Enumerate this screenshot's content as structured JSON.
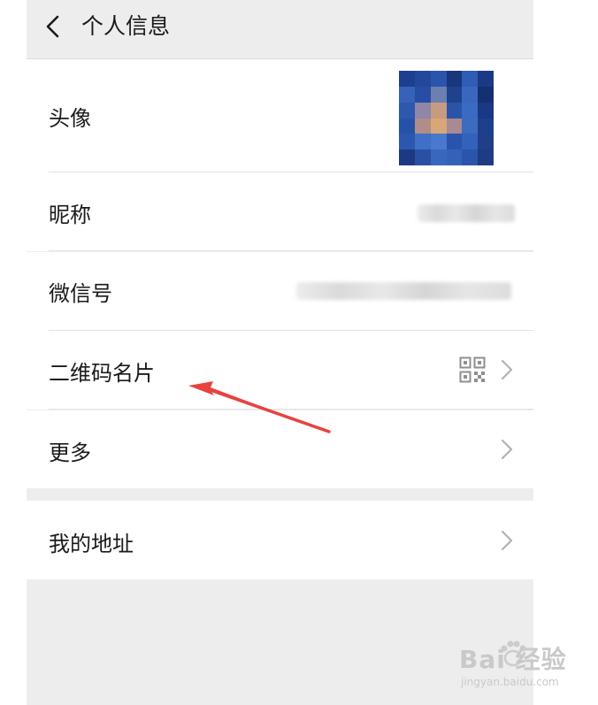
{
  "header": {
    "title": "个人信息",
    "back_icon": "chevron-left-icon"
  },
  "rows": {
    "avatar": {
      "label": "头像"
    },
    "nickname": {
      "label": "昵称"
    },
    "wechat_id": {
      "label": "微信号"
    },
    "qr_card": {
      "label": "二维码名片",
      "icon": "qr-code-icon"
    },
    "more": {
      "label": "更多"
    },
    "address": {
      "label": "我的地址"
    }
  },
  "annotation": {
    "color": "#e8423f",
    "points_to": "二维码名片"
  },
  "watermark": {
    "brand": "Bai 经验",
    "url": "jingyan.baidu.com"
  },
  "colors": {
    "background": "#ededed",
    "row_background": "#ffffff",
    "text": "#1a1a1a",
    "chevron": "#b2b2b2"
  }
}
